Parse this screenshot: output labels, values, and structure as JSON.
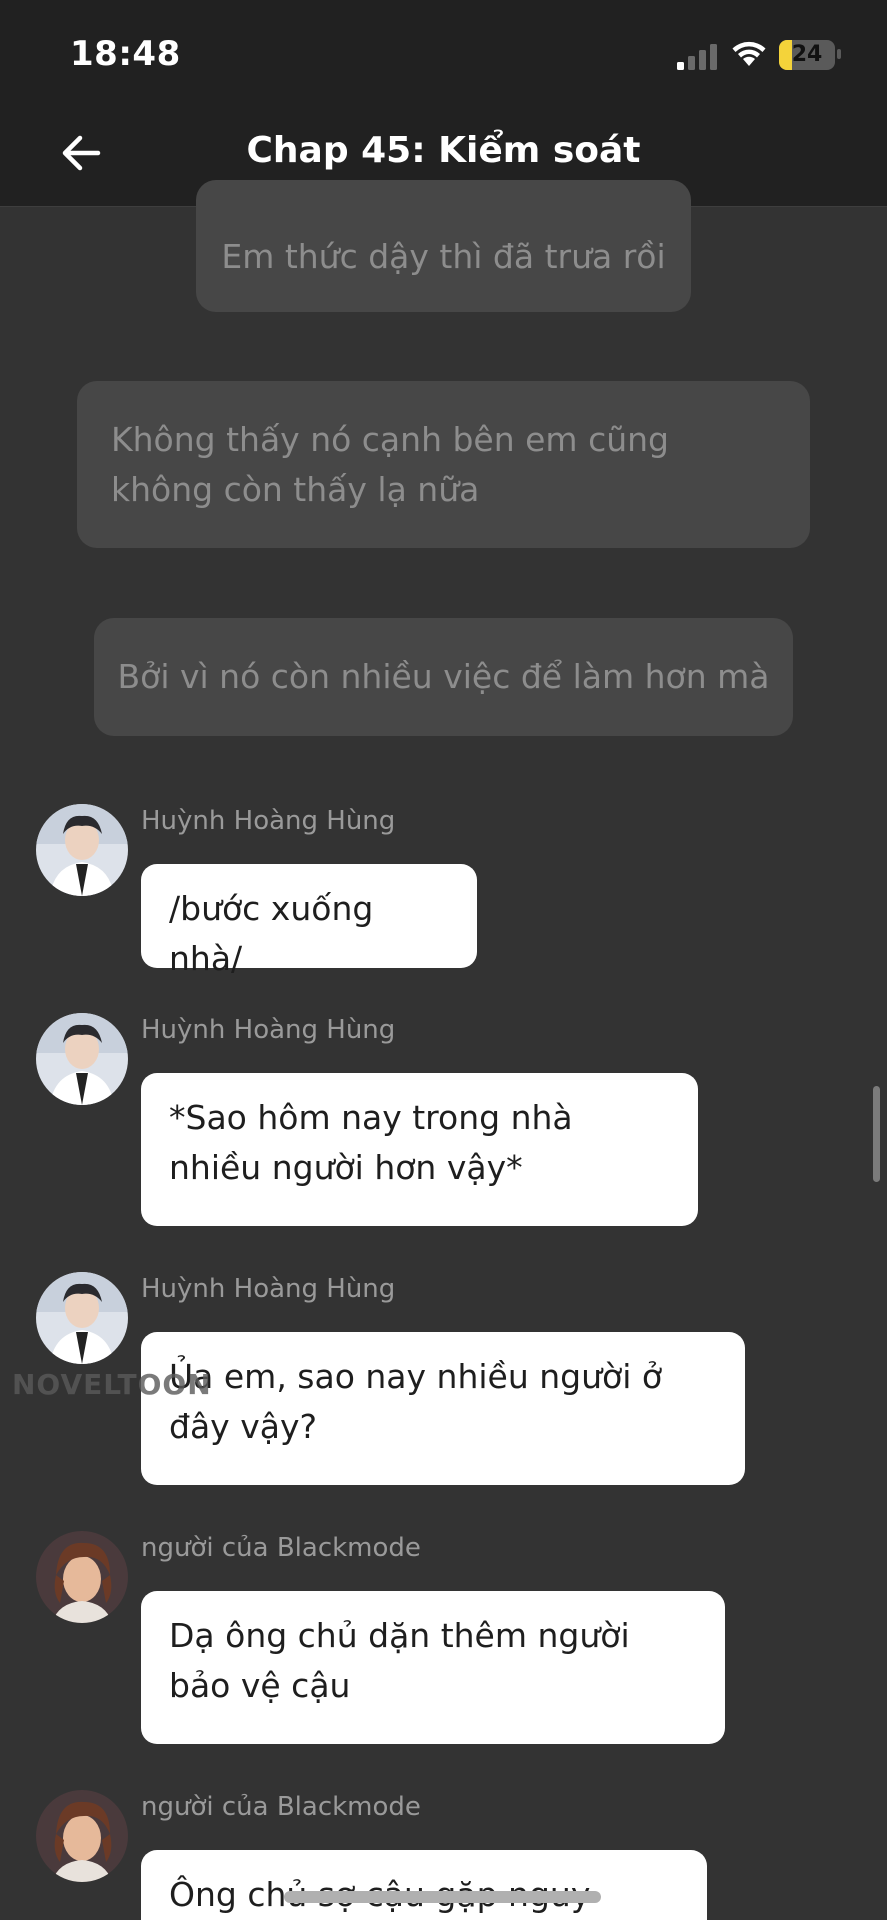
{
  "status_bar": {
    "time": "18:48",
    "battery_level": "24",
    "battery_fraction": 0.24,
    "signal_icon": "signal-bars-icon",
    "wifi_icon": "wifi-icon"
  },
  "header": {
    "title": "Chap 45: Kiểm soát",
    "back_icon": "arrow-left-icon"
  },
  "narrations": [
    "Em thức dậy thì đã trưa rồi",
    "Không thấy nó cạnh bên em cũng không còn thấy lạ nữa",
    "Bởi vì nó còn nhiều việc để làm hơn mà"
  ],
  "messages": [
    {
      "sender": "Huỳnh Hoàng Hùng",
      "text": "/bước xuống nhà/"
    },
    {
      "sender": "Huỳnh Hoàng Hùng",
      "text": "*Sao hôm nay trong nhà nhiều người hơn vậy*"
    },
    {
      "sender": "Huỳnh Hoàng Hùng",
      "text": "Ủa em, sao nay nhiều người ở đây vậy?"
    },
    {
      "sender": "người của Blackmode",
      "text": "Dạ ông chủ dặn thêm người bảo vệ cậu"
    },
    {
      "sender": "người của Blackmode",
      "text": "Ông chủ sợ cậu gặp nguy"
    }
  ],
  "watermark": "NOVELTOON",
  "colors": {
    "background": "#333333",
    "header": "#212121",
    "narration_bubble": "#474747",
    "narration_text": "#8d8d8d",
    "message_bubble": "#ffffff",
    "battery": "#f4d33a"
  }
}
